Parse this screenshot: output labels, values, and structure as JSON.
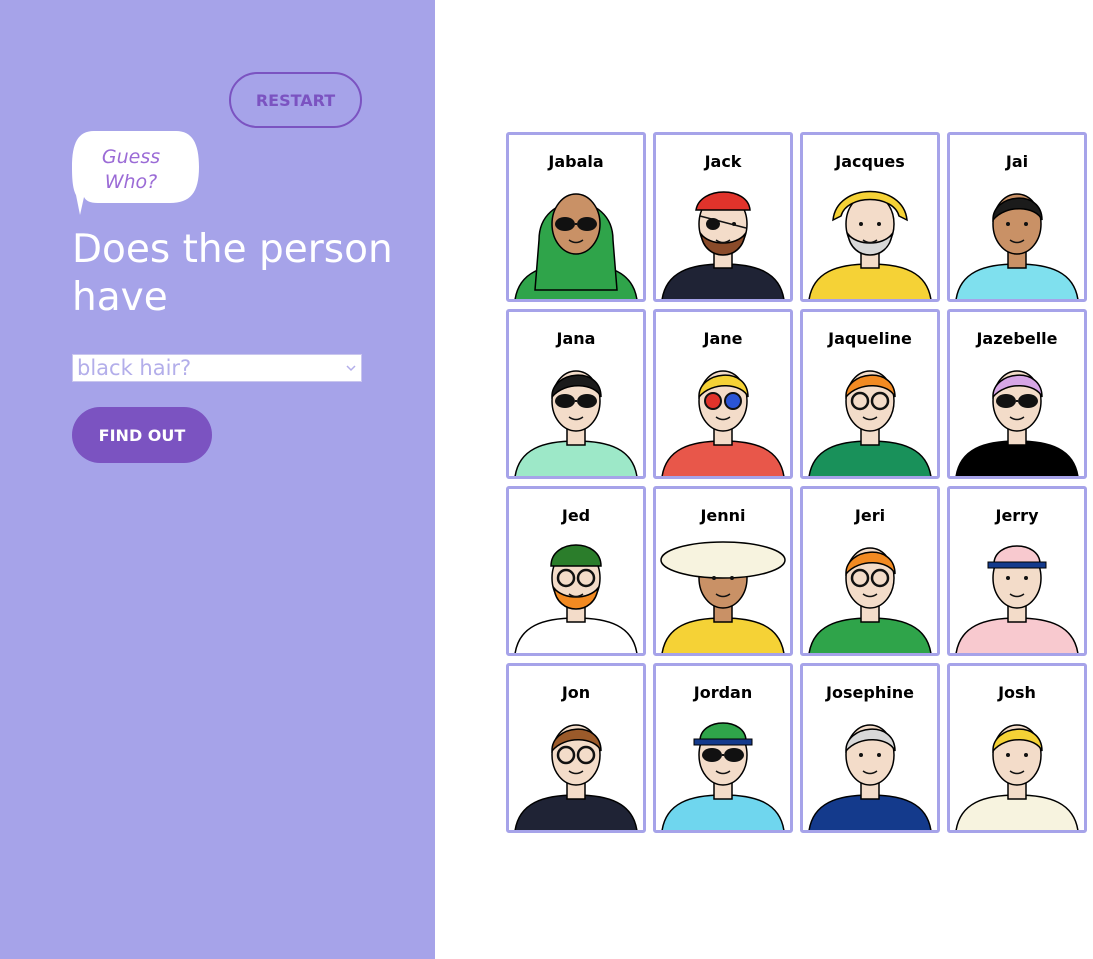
{
  "sidebar": {
    "restart_label": "RESTART",
    "logo_line1": "Guess",
    "logo_line2": "Who?",
    "question": "Does the person have",
    "select_value": "black hair?",
    "find_out_label": "FIND OUT"
  },
  "colors": {
    "sidebar_bg": "#a6a3e9",
    "accent": "#7b53c1",
    "card_border": "#a6a3e9"
  },
  "board": {
    "cards": [
      {
        "name": "Jabala",
        "skin": "#c99166",
        "hair": "#2fa44a",
        "shirt": "#2fa44a",
        "glasses": "sun",
        "hat": "hijab"
      },
      {
        "name": "Jack",
        "skin": "#f3dcc9",
        "hair": "#8a4b2a",
        "shirt": "#1f2335",
        "glasses": "eyepatch",
        "hat": "bandana-red",
        "beard": "#8a4b2a"
      },
      {
        "name": "Jacques",
        "skin": "#f3dcc9",
        "hair": "#d8d8d8",
        "shirt": "#f5d236",
        "glasses": "none",
        "hat": "sou-wester-yellow",
        "beard": "#d8d8d8"
      },
      {
        "name": "Jai",
        "skin": "#c99166",
        "hair": "#1b1b1b",
        "shirt": "#7fe0ee",
        "glasses": "none",
        "hat": "none"
      },
      {
        "name": "Jana",
        "skin": "#f3dcc9",
        "hair": "#1b1b1b",
        "shirt": "#9de8c8",
        "glasses": "sun",
        "hat": "none"
      },
      {
        "name": "Jane",
        "skin": "#f3dcc9",
        "hair": "#f5d236",
        "shirt": "#e8574a",
        "glasses": "3d",
        "hat": "none"
      },
      {
        "name": "Jaqueline",
        "skin": "#f3dcc9",
        "hair": "#f28a22",
        "shirt": "#19915a",
        "glasses": "round",
        "hat": "none"
      },
      {
        "name": "Jazebelle",
        "skin": "#f3dcc9",
        "hair": "#d7a6e6",
        "shirt": "#000000",
        "glasses": "sun",
        "hat": "none"
      },
      {
        "name": "Jed",
        "skin": "#f3dcc9",
        "hair": "#f28a22",
        "shirt": "#ffffff",
        "glasses": "round",
        "hat": "beanie-green",
        "beard": "#f28a22"
      },
      {
        "name": "Jenni",
        "skin": "#c99166",
        "hair": "#1b1b1b",
        "shirt": "#f5d236",
        "glasses": "none",
        "hat": "sunhat-white"
      },
      {
        "name": "Jeri",
        "skin": "#f3dcc9",
        "hair": "#f28a22",
        "shirt": "#2fa44a",
        "glasses": "round",
        "hat": "none"
      },
      {
        "name": "Jerry",
        "skin": "#f3dcc9",
        "hair": "#f3dcc9",
        "shirt": "#f8c9cf",
        "glasses": "none",
        "hat": "cap-pink"
      },
      {
        "name": "Jon",
        "skin": "#f3dcc9",
        "hair": "#9b5a2a",
        "shirt": "#1f2335",
        "glasses": "round",
        "hat": "none"
      },
      {
        "name": "Jordan",
        "skin": "#f3dcc9",
        "hair": "#f5d236",
        "shirt": "#6fd6ee",
        "glasses": "sun",
        "hat": "cap-green"
      },
      {
        "name": "Josephine",
        "skin": "#f3dcc9",
        "hair": "#d8d8d8",
        "shirt": "#143a8c",
        "glasses": "none",
        "hat": "none"
      },
      {
        "name": "Josh",
        "skin": "#f3dcc9",
        "hair": "#f5d236",
        "shirt": "#f7f3df",
        "glasses": "none",
        "hat": "none"
      }
    ]
  }
}
